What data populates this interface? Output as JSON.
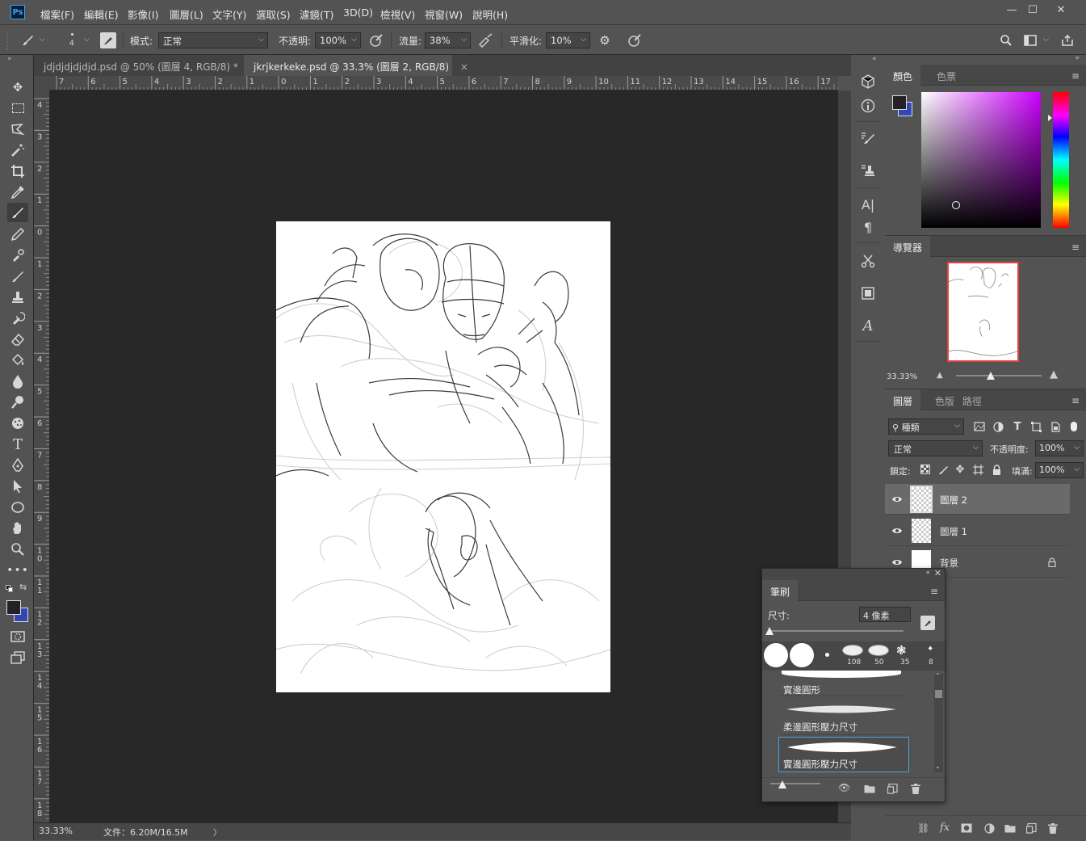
{
  "app": {
    "logo": "Ps"
  },
  "menu": [
    "檔案(F)",
    "編輯(E)",
    "影像(I)",
    "圖層(L)",
    "文字(Y)",
    "選取(S)",
    "濾鏡(T)",
    "3D(D)",
    "檢視(V)",
    "視窗(W)",
    "說明(H)"
  ],
  "window_buttons": {
    "minimize": "—",
    "maximize": "☐",
    "close": "✕"
  },
  "options": {
    "brush_size": "4",
    "mode_label": "模式:",
    "mode_value": "正常",
    "opacity_label": "不透明:",
    "opacity_value": "100%",
    "flow_label": "流量:",
    "flow_value": "38%",
    "smoothing_label": "平滑化:",
    "smoothing_value": "10%"
  },
  "tabs": [
    {
      "label": "jdjdjdjdjdjd.psd @ 50% (圖層 4, RGB/8) *",
      "close": "×"
    },
    {
      "label": "jkrjkerkeke.psd @ 33.3% (圖層 2, RGB/8)",
      "close": "×"
    }
  ],
  "ruler_top": [
    "7",
    "6",
    "5",
    "4",
    "3",
    "2",
    "1",
    "0",
    "1",
    "2",
    "3",
    "4",
    "5",
    "6",
    "7",
    "8",
    "9",
    "10",
    "11",
    "12",
    "13",
    "14",
    "15",
    "16",
    "17"
  ],
  "ruler_left": [
    "4",
    "3",
    "2",
    "1",
    "0",
    "1",
    "2",
    "3",
    "4",
    "5",
    "6",
    "7",
    "8",
    "9",
    "1\n0",
    "1\n1",
    "1\n2",
    "1\n3",
    "1\n4",
    "1\n5",
    "1\n6",
    "1\n7",
    "1\n8"
  ],
  "status": {
    "zoom": "33.33%",
    "doc_info": "文件：6.20M/16.5M",
    "arrow": "〉"
  },
  "color_panel": {
    "tabs": [
      "顏色",
      "色票"
    ],
    "foreground": "#262028",
    "background": "#3347b4",
    "hue": "#cc00ff"
  },
  "navigator": {
    "title": "導覽器",
    "zoom": "33.33%"
  },
  "layers_panel": {
    "tabs": [
      "圖層",
      "色版",
      "路徑"
    ],
    "filter_kind": "種類",
    "blend_mode": "正常",
    "opacity_label": "不透明度:",
    "opacity_value": "100%",
    "lock_label": "鎖定:",
    "fill_label": "填滿:",
    "fill_value": "100%",
    "layers": [
      {
        "name": "圖層 2",
        "selected": true,
        "type": "transparent"
      },
      {
        "name": "圖層 1",
        "selected": false,
        "type": "transparent"
      },
      {
        "name": "背景",
        "selected": false,
        "type": "white",
        "locked": true
      }
    ]
  },
  "brush_panel": {
    "title": "筆刷",
    "size_label": "尺寸:",
    "size_value": "4 像素",
    "presets": [
      {
        "label": ""
      },
      {
        "label": ""
      },
      {
        "label": ""
      },
      {
        "label": "108"
      },
      {
        "label": "50"
      },
      {
        "label": "35"
      },
      {
        "label": "8"
      }
    ],
    "brushes": [
      "實邊圓形",
      "柔邊圓形壓力尺寸",
      "實邊圓形壓力尺寸"
    ]
  }
}
